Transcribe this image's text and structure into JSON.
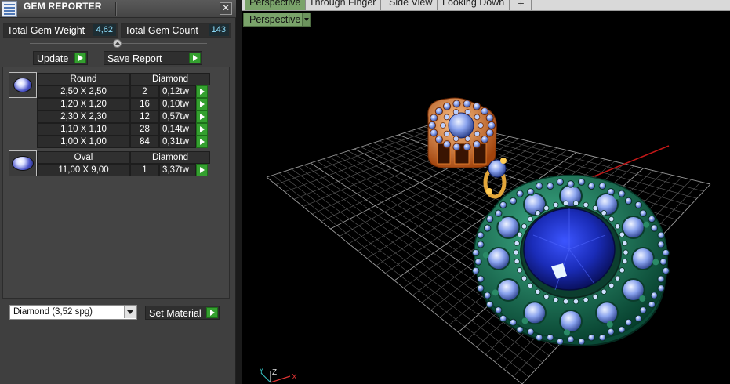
{
  "title": "GEM REPORTER",
  "close_glyph": "✕",
  "stats": {
    "weight_label": "Total Gem Weight",
    "weight_value": "4,62",
    "count_label": "Total Gem Count",
    "count_value": "143"
  },
  "buttons": {
    "update": "Update",
    "save_report": "Save Report",
    "set_material": "Set Material"
  },
  "gem_groups": [
    {
      "shape": "Round",
      "material": "Diamond",
      "icon": "round-gem-icon",
      "rows": [
        {
          "size": "2,50 X 2,50",
          "count": "2",
          "weight": "0,12tw"
        },
        {
          "size": "1,20 X 1,20",
          "count": "16",
          "weight": "0,10tw"
        },
        {
          "size": "2,30 X 2,30",
          "count": "12",
          "weight": "0,57tw"
        },
        {
          "size": "1,10 X 1,10",
          "count": "28",
          "weight": "0,14tw"
        },
        {
          "size": "1,00 X 1,00",
          "count": "84",
          "weight": "0,31tw"
        }
      ]
    },
    {
      "shape": "Oval",
      "material": "Diamond",
      "icon": "oval-gem-icon",
      "rows": [
        {
          "size": "11,00 X 9,00",
          "count": "1",
          "weight": "3,37tw"
        }
      ]
    }
  ],
  "material_select": {
    "value": "Diamond     (3,52 spg)"
  },
  "viewport": {
    "tabs": [
      "Perspective",
      "Through Finger",
      "Side View",
      "Looking Down"
    ],
    "active_tab": "Perspective",
    "add_tab_glyph": "+",
    "view_dropdown": "Perspective",
    "axis_y": "Y",
    "axis_z": "Z",
    "axis_x": "X"
  },
  "colors": {
    "panel_bg": "#3f3f3f",
    "play_green": "#34a02f",
    "value_cyan": "#8fe0ff",
    "tab_active": "#7aa36a",
    "sapphire": "#1d2fb0",
    "emerald_metal": "#0f6b4f",
    "gold": "#e07a2a"
  }
}
